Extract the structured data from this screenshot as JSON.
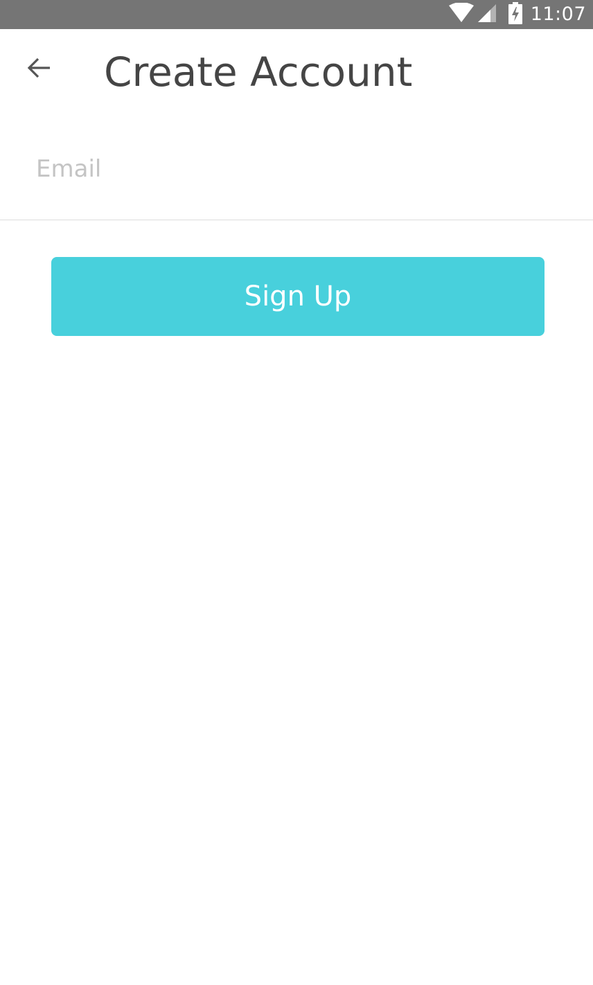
{
  "status_bar": {
    "time": "11:07",
    "icons": [
      "wifi-icon",
      "cell-signal-icon",
      "battery-charging-icon"
    ],
    "background": "#757575"
  },
  "toolbar": {
    "back_icon": "arrow-left-icon",
    "title": "Create Account"
  },
  "form": {
    "email": {
      "value": "",
      "placeholder": "Email"
    },
    "signup_label": "Sign Up"
  },
  "colors": {
    "accent": "#48d0dc",
    "title_text": "#454545",
    "placeholder_text": "#c4c4c4",
    "divider": "#dcdcdc"
  }
}
